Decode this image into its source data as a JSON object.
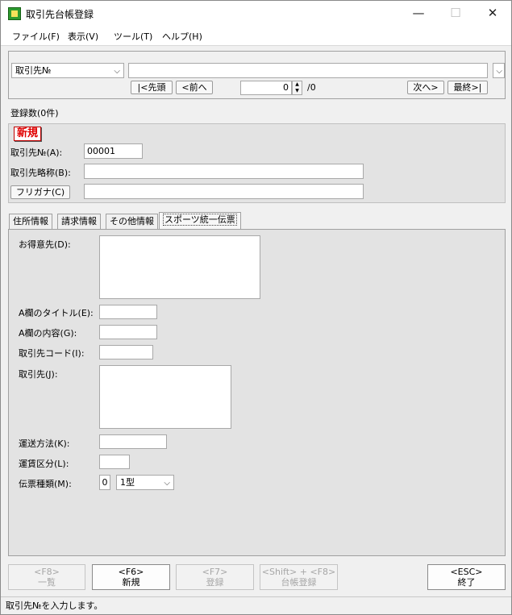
{
  "window": {
    "title": "取引先台帳登録",
    "minimize": "—",
    "maximize": "☐",
    "close": "✕"
  },
  "menu": [
    {
      "label": "ファイル(F)"
    },
    {
      "label": "表示(V)"
    },
    {
      "label": "ツール(T)"
    },
    {
      "label": "ヘルプ(H)"
    }
  ],
  "search": {
    "field_select": "取引先№",
    "value": "",
    "first": "|<先頭",
    "prev": "<前へ",
    "page_value": "0",
    "page_total": "/0",
    "next": "次へ>",
    "last": "最終>|"
  },
  "count_label": "登録数(0件)",
  "record": {
    "mode_badge": "新規",
    "code_label": "取引先№(A):",
    "code_value": "00001",
    "short_name_label": "取引先略称(B):",
    "short_name_value": "",
    "furigana_button": "フリガナ(C)",
    "furigana_value": ""
  },
  "tabs": [
    {
      "label": "住所情報"
    },
    {
      "label": "請求情報"
    },
    {
      "label": "その他情報"
    },
    {
      "label": "スポーツ統一伝票"
    }
  ],
  "sports": {
    "customer_label": "お得意先(D):",
    "a_title_label": "A欄のタイトル(E):",
    "a_content_label": "A欄の内容(G):",
    "partner_code_label": "取引先コード(I):",
    "partner_label": "取引先(J):",
    "shipping_label": "運送方法(K):",
    "freight_label": "運賃区分(L):",
    "slip_label": "伝票種類(M):",
    "slip_number": "0",
    "slip_type": "1型"
  },
  "fkeys": [
    {
      "key": "<F8>",
      "label": "一覧",
      "enabled": false
    },
    {
      "key": "<F6>",
      "label": "新規",
      "enabled": true
    },
    {
      "key": "<F7>",
      "label": "登録",
      "enabled": false
    },
    {
      "key": "<Shift> + <F8>",
      "label": "台帳登録",
      "enabled": false
    },
    {
      "key": "<ESC>",
      "label": "終了",
      "enabled": true
    }
  ],
  "status": "取引先№を入力します。"
}
